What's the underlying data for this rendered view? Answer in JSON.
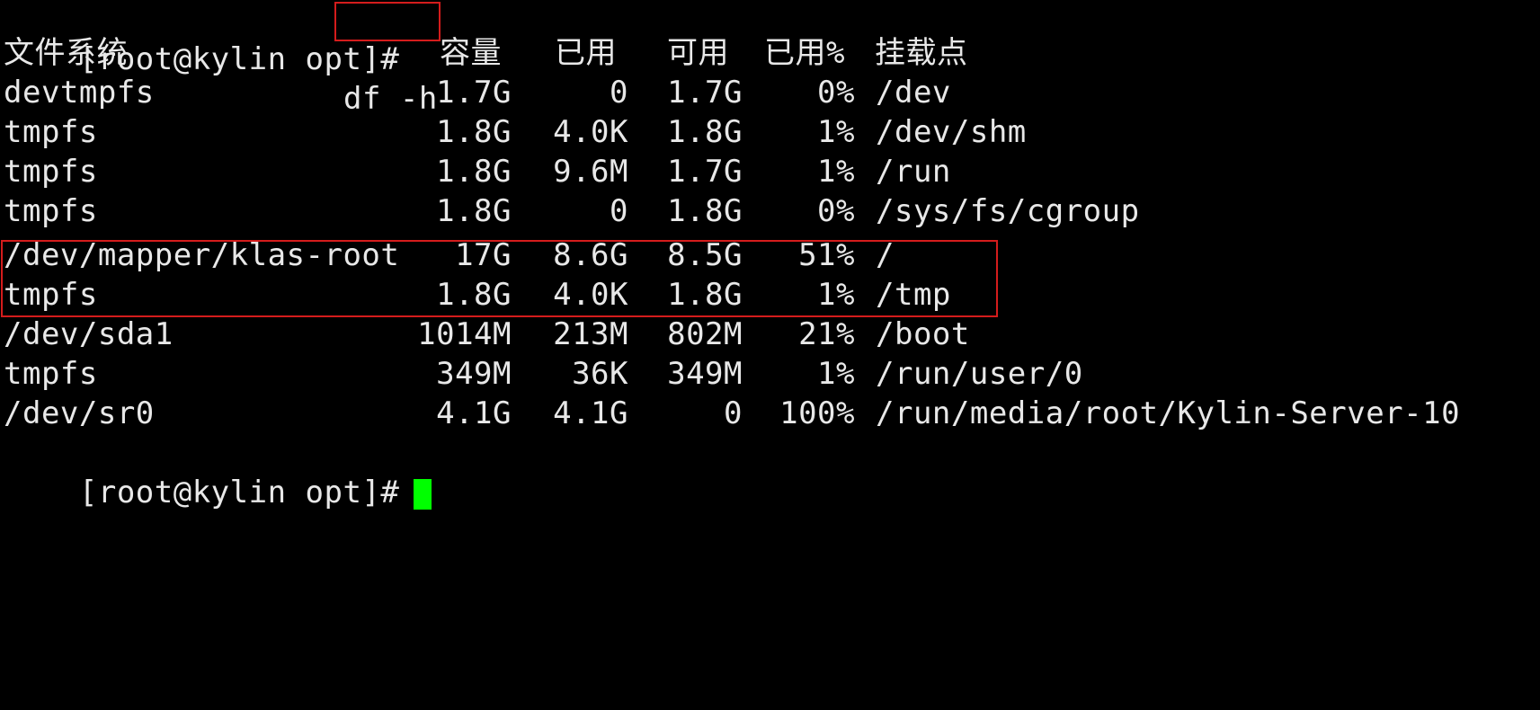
{
  "terminal": {
    "prompt": "[root@kylin opt]#",
    "command": "df -h",
    "header": {
      "filesystem": "文件系统",
      "size": "容量",
      "used": "已用",
      "avail": "可用",
      "use_pct": "已用%",
      "mounted_on": "挂载点"
    },
    "rows": [
      {
        "filesystem": "devtmpfs",
        "size": "1.7G",
        "used": "0",
        "avail": "1.7G",
        "use_pct": "0%",
        "mounted_on": "/dev"
      },
      {
        "filesystem": "tmpfs",
        "size": "1.8G",
        "used": "4.0K",
        "avail": "1.8G",
        "use_pct": "1%",
        "mounted_on": "/dev/shm"
      },
      {
        "filesystem": "tmpfs",
        "size": "1.8G",
        "used": "9.6M",
        "avail": "1.7G",
        "use_pct": "1%",
        "mounted_on": "/run"
      },
      {
        "filesystem": "tmpfs",
        "size": "1.8G",
        "used": "0",
        "avail": "1.8G",
        "use_pct": "0%",
        "mounted_on": "/sys/fs/cgroup"
      },
      {
        "filesystem": "/dev/mapper/klas-root",
        "size": "17G",
        "used": "8.6G",
        "avail": "8.5G",
        "use_pct": "51%",
        "mounted_on": "/"
      },
      {
        "filesystem": "tmpfs",
        "size": "1.8G",
        "used": "4.0K",
        "avail": "1.8G",
        "use_pct": "1%",
        "mounted_on": "/tmp"
      },
      {
        "filesystem": "/dev/sda1",
        "size": "1014M",
        "used": "213M",
        "avail": "802M",
        "use_pct": "21%",
        "mounted_on": "/boot"
      },
      {
        "filesystem": "tmpfs",
        "size": "349M",
        "used": "36K",
        "avail": "349M",
        "use_pct": "1%",
        "mounted_on": "/run/user/0"
      },
      {
        "filesystem": "/dev/sr0",
        "size": "4.1G",
        "used": "4.1G",
        "avail": "0",
        "use_pct": "100%",
        "mounted_on": "/run/media/root/Kylin-Server-10"
      }
    ],
    "final_prompt": "[root@kylin opt]#"
  },
  "colors": {
    "background": "#000000",
    "text": "#e8e8e8",
    "highlight_box": "#d41c1c",
    "cursor": "#00ff00"
  }
}
